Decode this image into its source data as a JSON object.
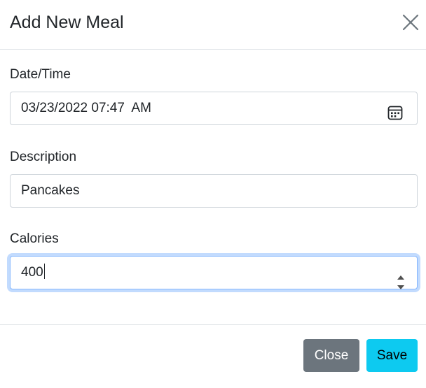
{
  "modal": {
    "title": "Add New Meal",
    "close_icon": "close-x-icon"
  },
  "form": {
    "datetime": {
      "label": "Date/Time",
      "value": "03/23/2022 07:47  AM",
      "icon": "calendar-icon"
    },
    "description": {
      "label": "Description",
      "value": "Pancakes"
    },
    "calories": {
      "label": "Calories",
      "value": "400"
    }
  },
  "footer": {
    "close_label": "Close",
    "save_label": "Save"
  },
  "colors": {
    "close_button": "#6c757d",
    "save_button": "#0dcaf0",
    "focus_ring": "#86b7fe"
  }
}
